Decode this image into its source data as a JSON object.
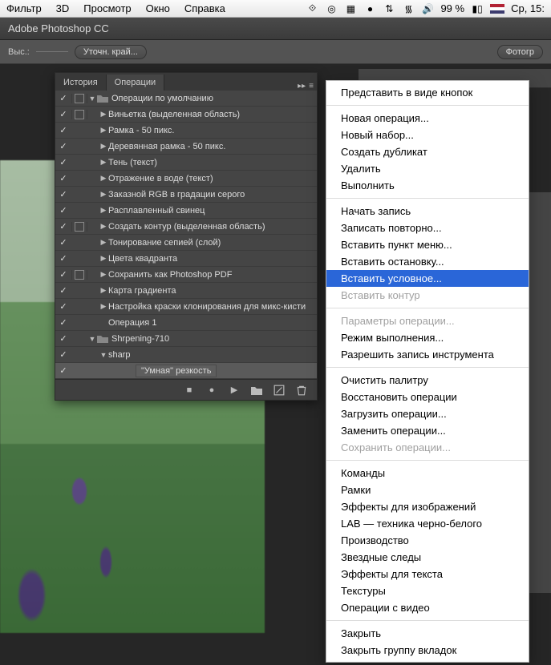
{
  "mac_menu": {
    "items": [
      "Фильтр",
      "3D",
      "Просмотр",
      "Окно",
      "Справка"
    ],
    "battery": "99 %",
    "clock": "Ср, 15:",
    "flag": "US"
  },
  "app_title": "Adobe Photoshop CC",
  "options_bar": {
    "label": "Выс.:",
    "refine": "Уточн. край...",
    "far_button": "Фотогр"
  },
  "panel": {
    "tabs": [
      "История",
      "Операции"
    ],
    "active_tab": 1,
    "rows": [
      {
        "chk": true,
        "box": true,
        "tog": "▼",
        "folder": true,
        "text": "Операции по умолчанию",
        "depth": 0
      },
      {
        "chk": true,
        "box": true,
        "tog": "▶",
        "text": "Виньетка (выделенная область)",
        "depth": 1
      },
      {
        "chk": true,
        "box": false,
        "tog": "▶",
        "text": "Рамка - 50 пикс.",
        "depth": 1
      },
      {
        "chk": true,
        "box": false,
        "tog": "▶",
        "text": "Деревянная рамка - 50 пикс.",
        "depth": 1
      },
      {
        "chk": true,
        "box": false,
        "tog": "▶",
        "text": "Тень (текст)",
        "depth": 1
      },
      {
        "chk": true,
        "box": false,
        "tog": "▶",
        "text": "Отражение в воде (текст)",
        "depth": 1
      },
      {
        "chk": true,
        "box": false,
        "tog": "▶",
        "text": "Заказной RGB в градации серого",
        "depth": 1
      },
      {
        "chk": true,
        "box": false,
        "tog": "▶",
        "text": "Расплавленный свинец",
        "depth": 1
      },
      {
        "chk": true,
        "box": true,
        "tog": "▶",
        "text": "Создать контур (выделенная область)",
        "depth": 1
      },
      {
        "chk": true,
        "box": false,
        "tog": "▶",
        "text": "Тонирование сепией (слой)",
        "depth": 1
      },
      {
        "chk": true,
        "box": false,
        "tog": "▶",
        "text": "Цвета квадранта",
        "depth": 1
      },
      {
        "chk": true,
        "box": true,
        "tog": "▶",
        "text": "Сохранить как Photoshop PDF",
        "depth": 1
      },
      {
        "chk": true,
        "box": false,
        "tog": "▶",
        "text": "Карта градиента",
        "depth": 1
      },
      {
        "chk": true,
        "box": false,
        "tog": "▶",
        "text": "Настройка краски клонирования для микс-кисти",
        "depth": 1
      },
      {
        "chk": true,
        "box": false,
        "tog": "",
        "text": "Операция 1",
        "depth": 1
      },
      {
        "chk": true,
        "box": false,
        "tog": "▼",
        "folder": true,
        "text": "Shrpening-710",
        "depth": 0
      },
      {
        "chk": true,
        "box": false,
        "tog": "▼",
        "text": "sharp",
        "depth": 1
      },
      {
        "chk": true,
        "box": false,
        "tog": "",
        "step": true,
        "text": "\"Умная\" резкость",
        "depth": 2,
        "sel": true
      }
    ],
    "footer_icons": [
      "stop",
      "record",
      "play",
      "newset",
      "newaction",
      "trash"
    ]
  },
  "flyout": {
    "items": [
      {
        "t": "Представить в виде кнопок"
      },
      {
        "sep": true
      },
      {
        "t": "Новая операция..."
      },
      {
        "t": "Новый набор..."
      },
      {
        "t": "Создать дубликат"
      },
      {
        "t": "Удалить"
      },
      {
        "t": "Выполнить"
      },
      {
        "sep": true
      },
      {
        "t": "Начать запись"
      },
      {
        "t": "Записать повторно..."
      },
      {
        "t": "Вставить пункт меню..."
      },
      {
        "t": "Вставить остановку..."
      },
      {
        "t": "Вставить условное...",
        "hl": true
      },
      {
        "t": "Вставить контур",
        "dis": true
      },
      {
        "sep": true
      },
      {
        "t": "Параметры операции...",
        "dis": true
      },
      {
        "t": "Режим выполнения..."
      },
      {
        "t": "Разрешить запись инструмента"
      },
      {
        "sep": true
      },
      {
        "t": "Очистить палитру"
      },
      {
        "t": "Восстановить операции"
      },
      {
        "t": "Загрузить операции..."
      },
      {
        "t": "Заменить операции..."
      },
      {
        "t": "Сохранить операции...",
        "dis": true
      },
      {
        "sep": true
      },
      {
        "t": "Команды"
      },
      {
        "t": "Рамки"
      },
      {
        "t": "Эффекты для изображений"
      },
      {
        "t": "LAB — техника черно-белого"
      },
      {
        "t": "Производство"
      },
      {
        "t": "Звездные следы"
      },
      {
        "t": "Эффекты для текста"
      },
      {
        "t": "Текстуры"
      },
      {
        "t": "Операции с видео"
      },
      {
        "sep": true
      },
      {
        "t": "Закрыть"
      },
      {
        "t": "Закрыть группу вкладок"
      }
    ]
  }
}
